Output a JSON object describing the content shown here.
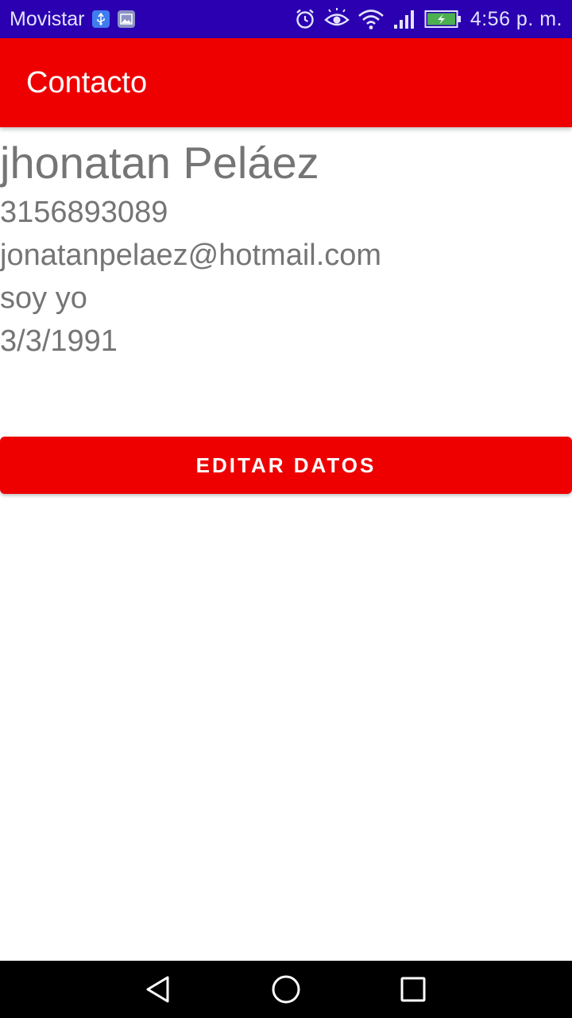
{
  "status_bar": {
    "carrier": "Movistar",
    "time": "4:56 p. m.",
    "icons": [
      "usb-icon",
      "image-icon",
      "alarm-icon",
      "eye-icon",
      "wifi-icon",
      "signal-icon",
      "battery-icon"
    ]
  },
  "app_bar": {
    "title": "Contacto"
  },
  "contact": {
    "name": "jhonatan Peláez",
    "phone": "3156893089",
    "email": "jonatanpelaez@hotmail.com",
    "description": "soy yo",
    "birthdate": "3/3/1991"
  },
  "actions": {
    "edit_label": "EDITAR DATOS"
  },
  "nav_bar": {
    "icons": [
      "back-icon",
      "home-icon",
      "recents-icon"
    ]
  },
  "colors": {
    "status_bar": "#2a00b0",
    "primary": "#ee0000",
    "text_secondary": "#757575",
    "nav_bar": "#000000"
  }
}
